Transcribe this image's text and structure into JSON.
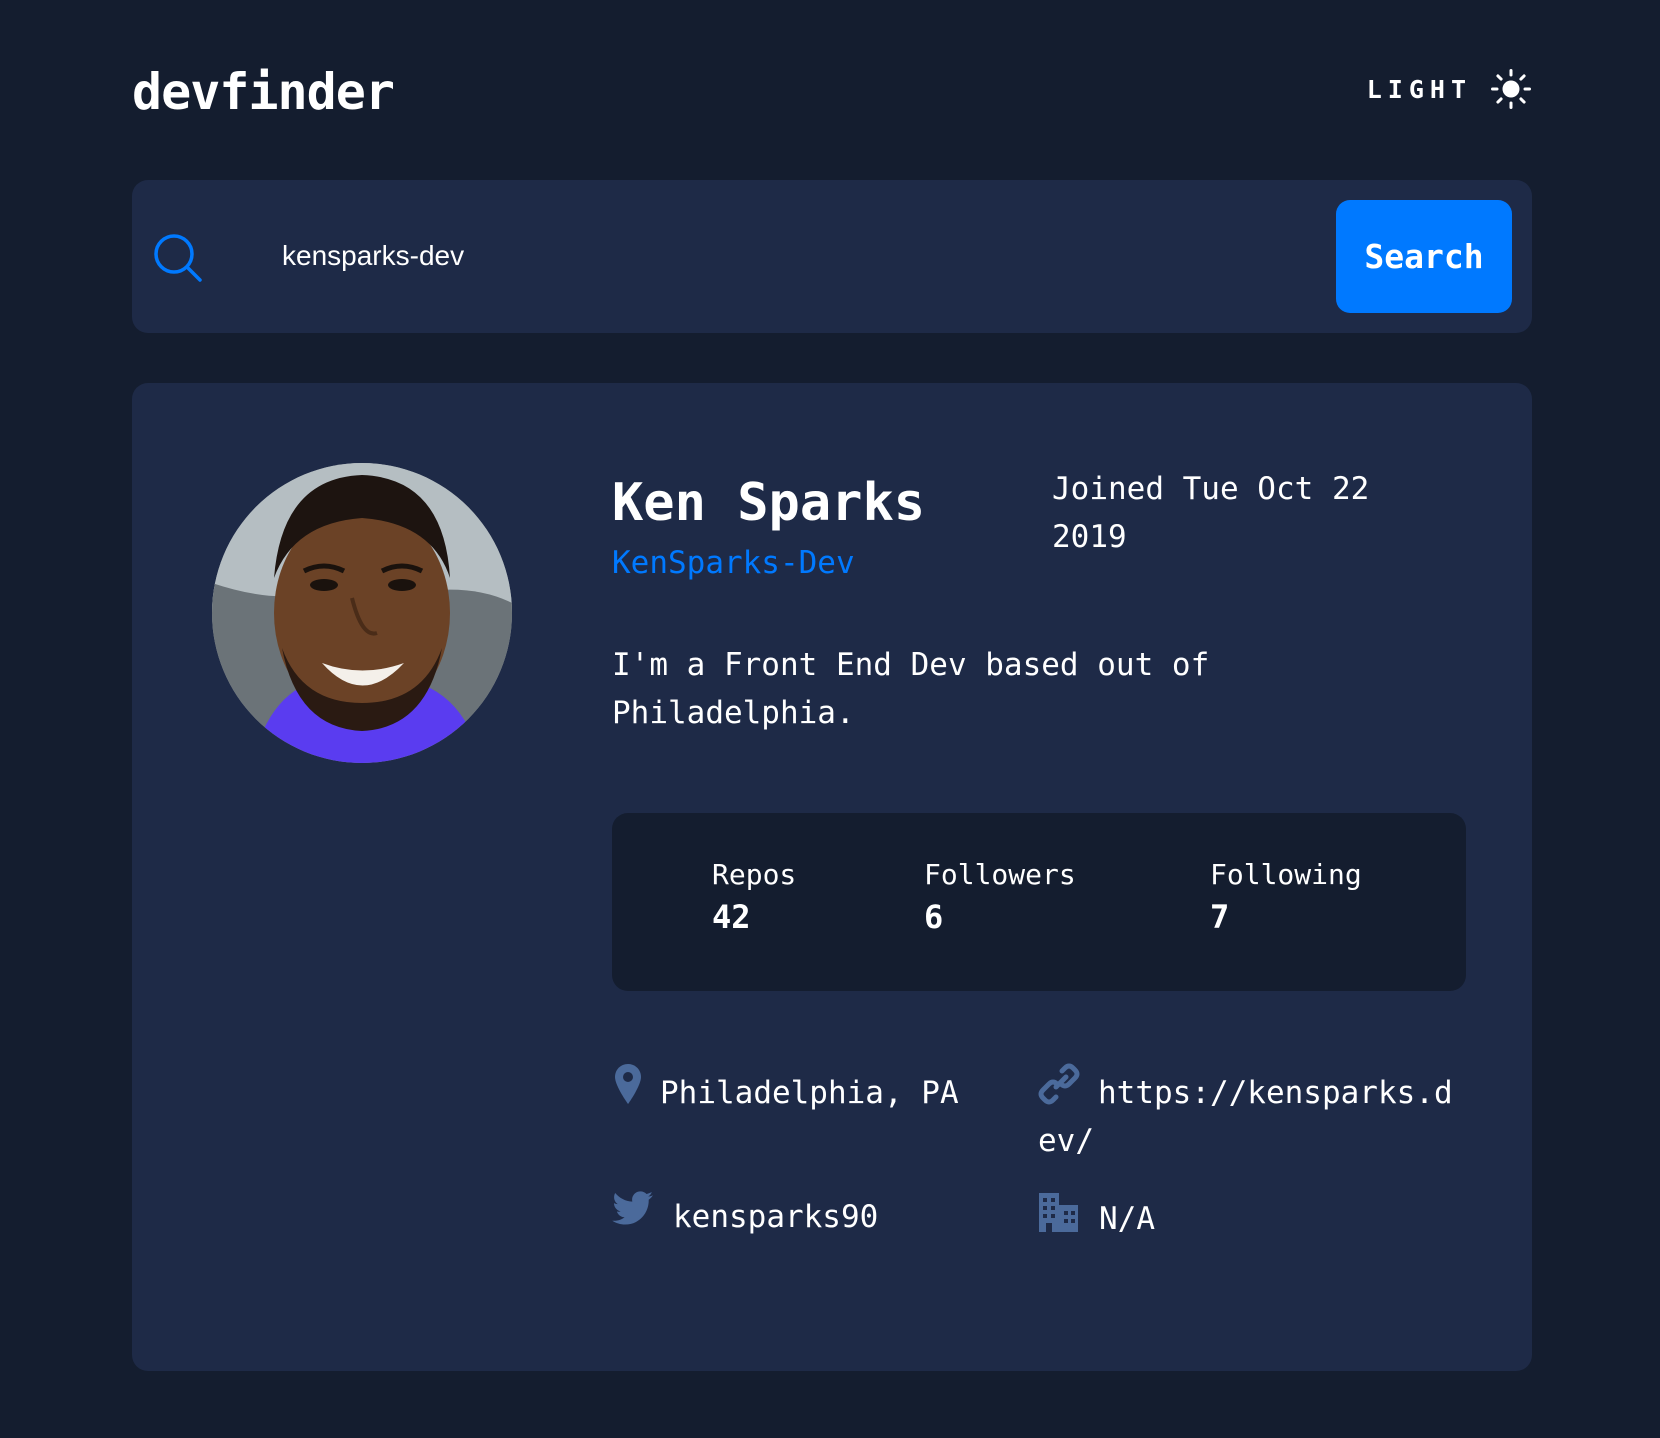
{
  "app": {
    "logo": "devfinder",
    "theme_toggle_label": "LIGHT"
  },
  "search": {
    "value": "kensparks-dev",
    "button_label": "Search"
  },
  "profile": {
    "name": "Ken Sparks",
    "login": "KenSparks-Dev",
    "joined": "Joined Tue Oct 22 2019",
    "bio": "I'm a Front End Dev based out of Philadelphia.",
    "stats": {
      "repos_label": "Repos",
      "repos_value": "42",
      "followers_label": "Followers",
      "followers_value": "6",
      "following_label": "Following",
      "following_value": "7"
    },
    "links": {
      "location": "Philadelphia, PA",
      "blog": "https://kensparks.dev/",
      "twitter": "kensparks90",
      "company": "N/A"
    }
  },
  "colors": {
    "page_background": "#141d2f",
    "card_background": "#1e2a47",
    "accent": "#0079ff",
    "icon_muted": "#4b6a9b",
    "text": "#ffffff"
  },
  "icons": {
    "theme": "sun-icon",
    "search": "search-icon",
    "location": "location-pin-icon",
    "blog": "link-icon",
    "twitter": "twitter-icon",
    "company": "building-icon"
  }
}
